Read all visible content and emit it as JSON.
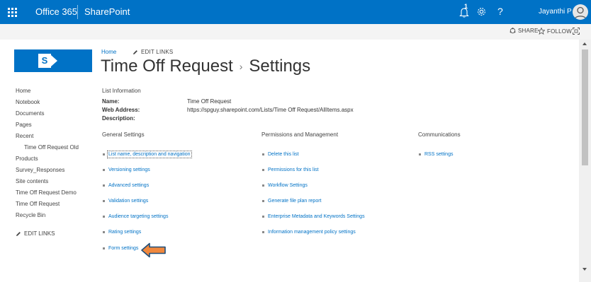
{
  "suite_bar": {
    "brand": "Office 365",
    "app": "SharePoint",
    "notification_count": "1",
    "help": "?",
    "user_name": "Jayanthi P",
    "color": "#0072c6"
  },
  "action_bar": {
    "share": "SHARE",
    "follow": "FOLLOW"
  },
  "logo": {
    "letter": "S"
  },
  "header": {
    "home": "Home",
    "edit_links": "EDIT LINKS",
    "title_list": "Time Off Request",
    "title_sep": "›",
    "title_page": "Settings"
  },
  "left_nav": {
    "items": [
      "Home",
      "Notebook",
      "Documents",
      "Pages",
      "Recent",
      "Time Off Request Old",
      "Products",
      "Survey_Responses",
      "Site contents",
      "Time Off Request Demo",
      "Time Off Request",
      "Recycle Bin"
    ],
    "edit_links": "EDIT LINKS"
  },
  "list_information": {
    "title": "List Information",
    "name_label": "Name:",
    "name_value": "Time Off Request",
    "web_address_label": "Web Address:",
    "web_address_value": "https://spguy.sharepoint.com/Lists/Time Off Request/AllItems.aspx",
    "description_label": "Description:"
  },
  "general_settings": {
    "heading": "General Settings",
    "links": [
      "List name, description and navigation",
      "Versioning settings",
      "Advanced settings",
      "Validation settings",
      "Audience targeting settings",
      "Rating settings",
      "Form settings"
    ]
  },
  "permissions": {
    "heading": "Permissions and Management",
    "links": [
      "Delete this list",
      "Permissions for this list",
      "Workflow Settings",
      "Generate file plan report",
      "Enterprise Metadata and Keywords Settings",
      "Information management policy settings"
    ]
  },
  "communications": {
    "heading": "Communications",
    "links": [
      "RSS settings"
    ]
  },
  "colors": {
    "accent": "#0072c6",
    "arrow": "#f0883e"
  }
}
